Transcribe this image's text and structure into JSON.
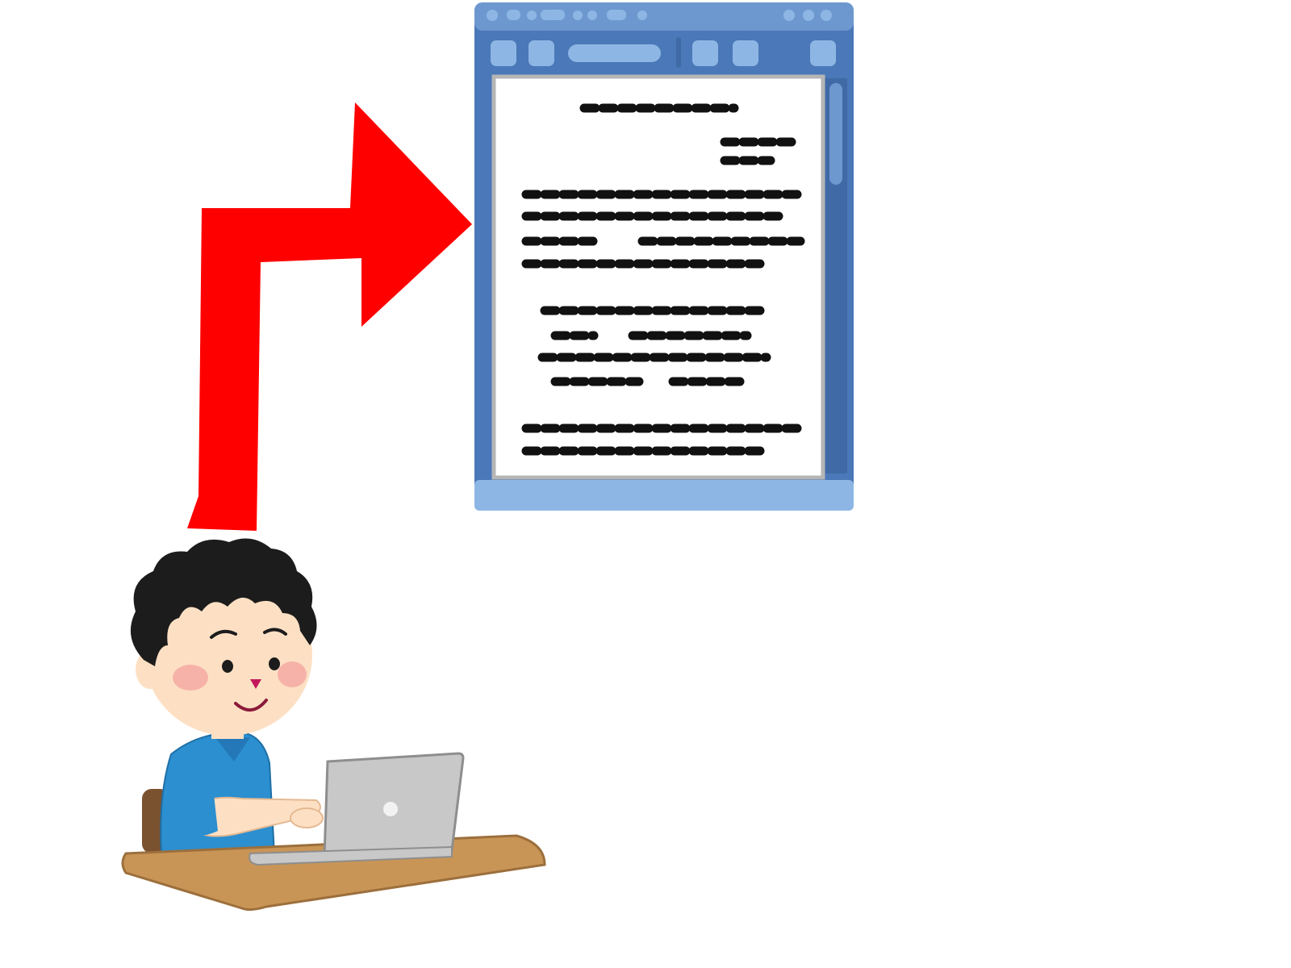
{
  "colors": {
    "arrow": "#ff0000",
    "window_frame": "#4a78b8",
    "window_frame_light": "#8eb6e4",
    "window_titlebar": "#6d98cf",
    "document_paper": "#ffffff",
    "document_text": "#111111",
    "hair": "#1c1c1c",
    "skin": "#fde0c4",
    "cheek": "#f6b2a8",
    "shirt": "#2b8fd0",
    "laptop": "#c8c8c8",
    "desk": "#c99556",
    "chair": "#7a5230"
  },
  "icons": [
    "bent-arrow-icon",
    "document-window-icon",
    "person-at-laptop-illustration"
  ]
}
